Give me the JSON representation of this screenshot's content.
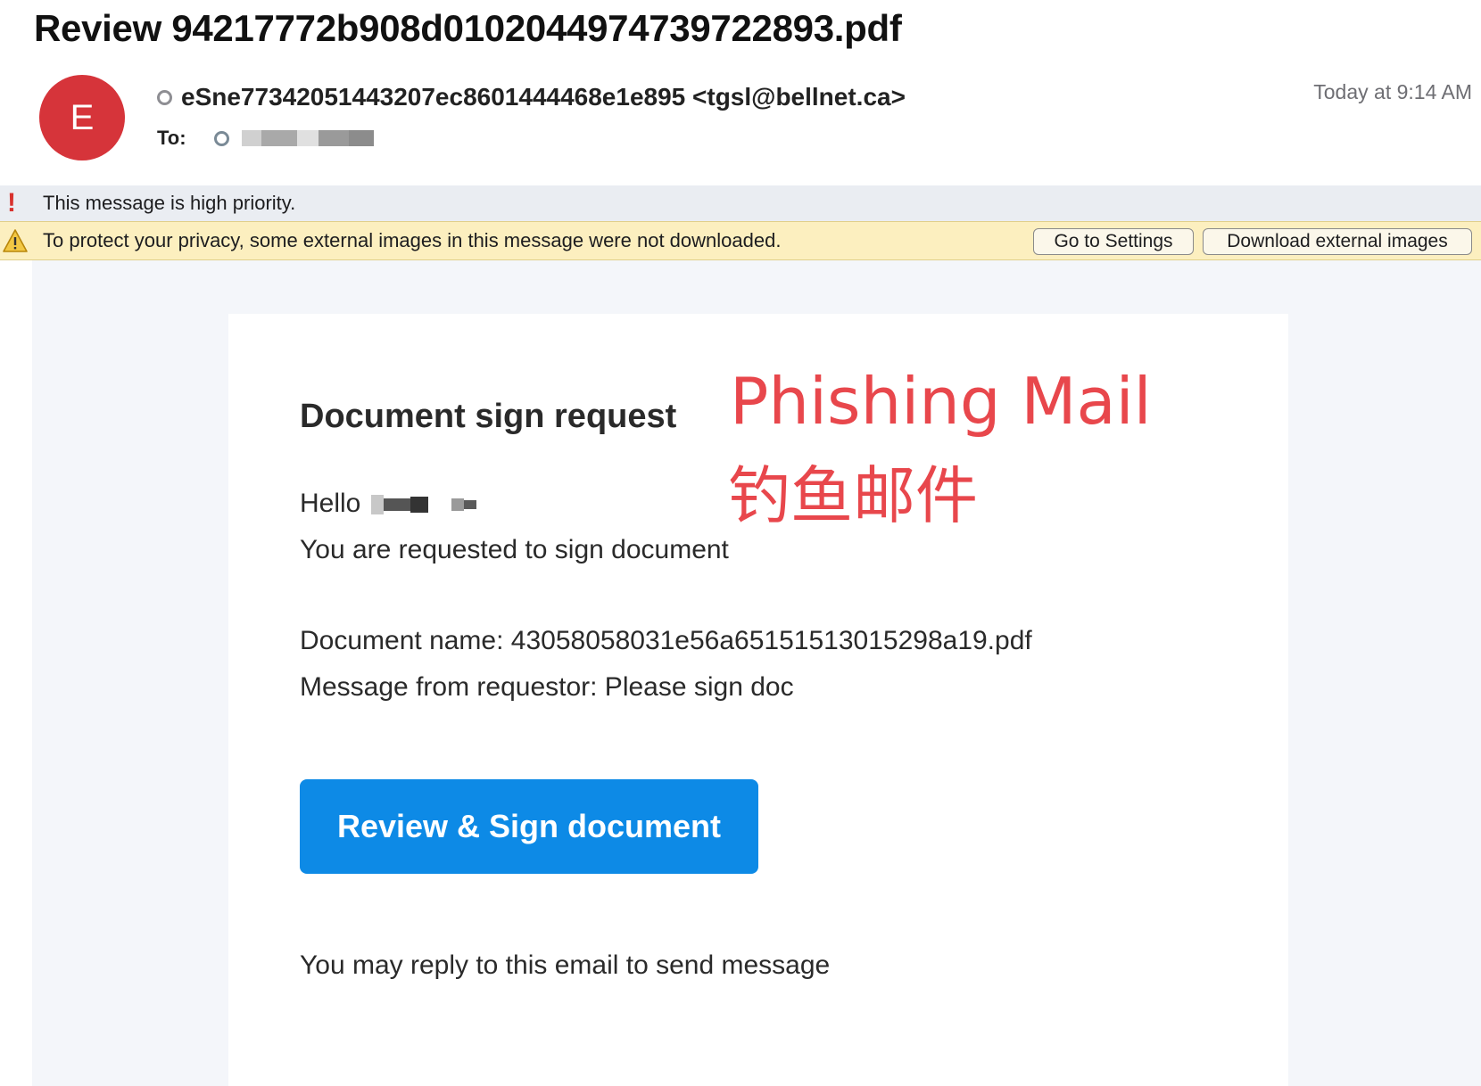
{
  "subject": "Review 94217772b908d0102044974739722893.pdf",
  "sender": {
    "avatar_letter": "E",
    "avatar_color": "#d6343a",
    "display": "eSne77342051443207ec8601444468e1e895 <tgsl@bellnet.ca>"
  },
  "recipient": {
    "label": "To:"
  },
  "date": "Today at 9:14 AM",
  "banners": {
    "priority_text": "This message is high priority.",
    "privacy_text": "To protect your privacy, some external images in this message were not downloaded.",
    "go_to_settings": "Go to Settings",
    "download_images": "Download external images"
  },
  "email_body": {
    "title": "Document sign request",
    "greeting": "Hello",
    "requested": "You are requested to sign document",
    "document_name": "Document name: 43058058031e56a65151513015298a19.pdf",
    "message_from": "Message from requestor: Please sign doc",
    "cta_label": "Review & Sign document",
    "reply_note": "You may reply to this email to send message"
  },
  "annotation": {
    "english": "Phishing Mail",
    "chinese": "钓鱼邮件",
    "color": "#e8474c"
  },
  "colors": {
    "cta": "#0d8ae6",
    "priority_mark": "#d8322e",
    "privacy_banner": "#fcefbf"
  },
  "icons": {
    "priority": "exclamation-icon",
    "privacy": "warning-triangle-icon"
  }
}
